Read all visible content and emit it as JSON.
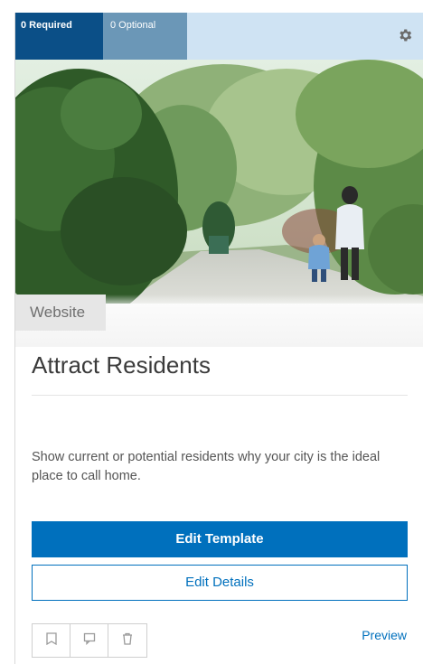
{
  "header": {
    "tabs": [
      {
        "label": "0 Required"
      },
      {
        "label": "0 Optional"
      }
    ],
    "settings_icon": "gear-icon"
  },
  "card": {
    "type_label": "Website",
    "title": "Attract Residents",
    "description": "Show current or potential residents why your city is the ideal place to call home.",
    "primary_button": "Edit Template",
    "secondary_button": "Edit Details",
    "actions": [
      {
        "icon": "save-icon"
      },
      {
        "icon": "comment-icon"
      },
      {
        "icon": "delete-icon"
      }
    ],
    "preview_link": "Preview"
  },
  "colors": {
    "header_bg": "#cfe3f3",
    "required_tab": "#0b4f87",
    "optional_tab": "#6b97b7",
    "accent": "#0070bd"
  }
}
